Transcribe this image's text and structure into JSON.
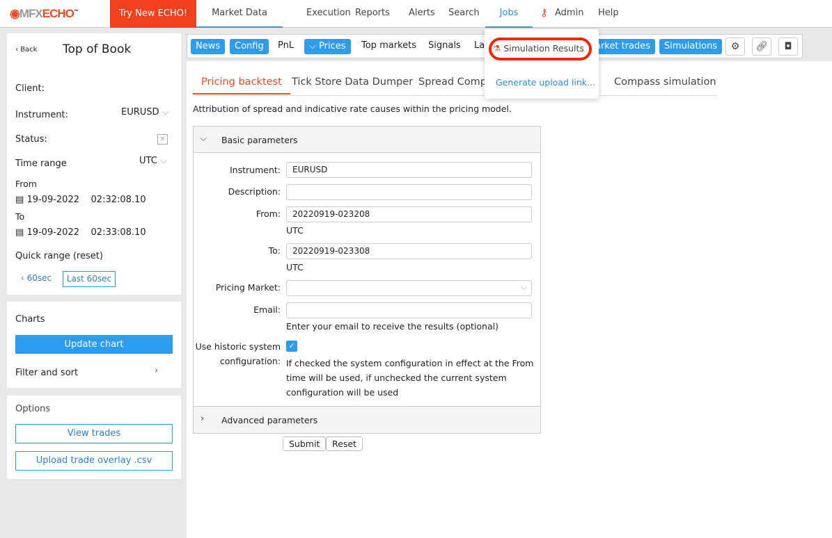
{
  "header": {
    "logo_mfx": "MFX",
    "logo_echo": "ECHO",
    "logo_tm": "™",
    "try_new": "Try New ECHO!",
    "nav": [
      "Market Data",
      "Execution",
      "Reports",
      "Alerts",
      "Search",
      "Jobs",
      "Admin",
      "Help"
    ]
  },
  "jobs_menu": {
    "items": [
      "Simulation Results",
      "Generate upload link..."
    ]
  },
  "sidebar": {
    "back": "Back",
    "title": "Top of Book",
    "client_label": "Client:",
    "instrument_label": "Instrument:",
    "instrument_value": "EURUSD",
    "status_label": "Status:",
    "time_range_label": "Time range",
    "time_range_value": "UTC",
    "from_label": "From",
    "from_date": "19-09-2022",
    "from_time": "02:32:08.10",
    "to_label": "To",
    "to_date": "19-09-2022",
    "to_time": "02:33:08.10",
    "quick_range": "Quick range (reset)",
    "prev_60": "60sec",
    "last_60": "Last 60sec",
    "charts_title": "Charts",
    "update_chart": "Update chart",
    "filter_sort": "Filter and sort",
    "options_title": "Options",
    "view_trades": "View trades",
    "upload_overlay": "Upload trade overlay .csv"
  },
  "toolbar": {
    "news": "News",
    "config": "Config",
    "pnl": "PnL",
    "prices": "Prices",
    "top_markets": "Top markets",
    "signals": "Signals",
    "la": "La",
    "market_trades": "arket trades",
    "simulations": "Simulations"
  },
  "tabs": [
    "Pricing backtest",
    "Tick Store Data Dumper",
    "Spread Compa",
    "Compass simulation"
  ],
  "description": "Attribution of spread and indicative rate causes within the pricing model.",
  "form": {
    "basic": "Basic parameters",
    "advanced": "Advanced parameters",
    "instrument_label": "Instrument:",
    "instrument_value": "EURUSD",
    "description_label": "Description:",
    "description_value": "",
    "from_label": "From:",
    "from_value": "20220919-023208",
    "from_tz": "UTC",
    "to_label": "To:",
    "to_value": "20220919-023308",
    "to_tz": "UTC",
    "pricing_market_label": "Pricing Market:",
    "email_label": "Email:",
    "email_help": "Enter your email to receive the results (optional)",
    "historic_label_1": "Use historic system",
    "historic_label_2": "configuration:",
    "historic_checked": true,
    "historic_help": [
      "If checked the system configuration in effect at the From",
      "time will be used, if unchecked the current system",
      "configuration will be used"
    ],
    "submit": "Submit",
    "reset": "Reset"
  },
  "colors": {
    "accent": "#2d9bf0",
    "brand": "#f5401e",
    "highlight": "#ff2200"
  }
}
